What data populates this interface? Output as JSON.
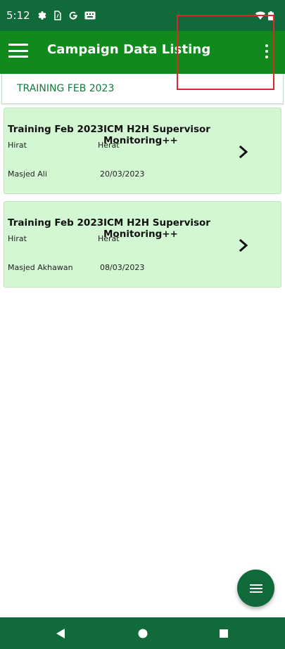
{
  "status_bar": {
    "time": "5:12",
    "icons": [
      "gear-icon",
      "sim-card-icon",
      "google-icon",
      "keyboard-icon",
      "wifi-icon",
      "battery-icon"
    ]
  },
  "app_bar": {
    "title": "Campaign Data Listing",
    "menu_icon": "hamburger-menu-icon",
    "overflow_icon": "more-vert-icon"
  },
  "filter": {
    "label": "TRAINING FEB 2023"
  },
  "records": [
    {
      "campaign": "Training Feb 2023",
      "survey": "ICM H2H Supervisor Monitoring++",
      "province": "Hirat",
      "district": "Herat",
      "name": "Masjed Ali",
      "date": "20/03/2023"
    },
    {
      "campaign": "Training Feb 2023",
      "survey": "ICM H2H Supervisor Monitoring++",
      "province": "Hirat",
      "district": "Herat",
      "name": "Masjed Akhawan",
      "date": "08/03/2023"
    }
  ],
  "fab": {
    "icon": "menu-icon"
  },
  "nav_bar": {
    "icons": [
      "back-icon",
      "home-icon",
      "recents-icon"
    ]
  },
  "colors": {
    "status_bar": "#106a3a",
    "app_bar": "#10891d",
    "card_background": "#d4f7d3",
    "accent_text": "#137a3d",
    "highlight": "#e0252d"
  }
}
